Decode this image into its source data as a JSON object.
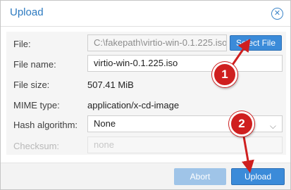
{
  "dialog": {
    "title": "Upload",
    "close_icon": "close-icon"
  },
  "form": {
    "file": {
      "label": "File:",
      "value": "C:\\fakepath\\virtio-win-0.1.225.iso",
      "button_label": "Select File"
    },
    "file_name": {
      "label": "File name:",
      "value": "virtio-win-0.1.225.iso"
    },
    "file_size": {
      "label": "File size:",
      "value": "507.41 MiB"
    },
    "mime_type": {
      "label": "MIME type:",
      "value": "application/x-cd-image"
    },
    "hash_algorithm": {
      "label": "Hash algorithm:",
      "value": "None"
    },
    "checksum": {
      "label": "Checksum:",
      "placeholder": "none"
    }
  },
  "footer": {
    "abort_label": "Abort",
    "upload_label": "Upload"
  },
  "annotations": [
    {
      "number": "1"
    },
    {
      "number": "2"
    }
  ],
  "colors": {
    "accent": "#3b8bd9",
    "title": "#2c7ac0",
    "annotation": "#cf1f1f"
  }
}
